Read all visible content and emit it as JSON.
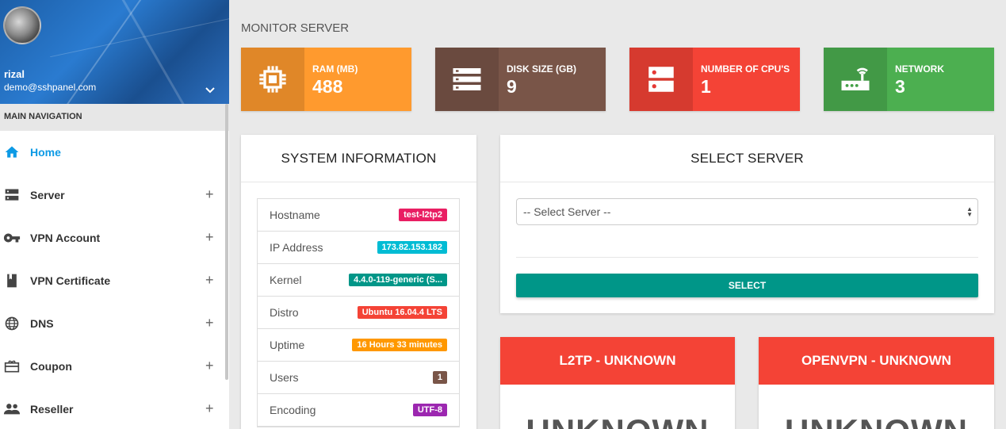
{
  "user": {
    "name": "rizal",
    "email": "demo@sshpanel.com"
  },
  "nav": {
    "header": "MAIN NAVIGATION",
    "items": [
      {
        "label": "Home",
        "icon": "home-icon",
        "active": true,
        "expandable": false
      },
      {
        "label": "Server",
        "icon": "server-icon",
        "active": false,
        "expandable": true
      },
      {
        "label": "VPN Account",
        "icon": "key-icon",
        "active": false,
        "expandable": true
      },
      {
        "label": "VPN Certificate",
        "icon": "certificate-icon",
        "active": false,
        "expandable": true
      },
      {
        "label": "DNS",
        "icon": "globe-icon",
        "active": false,
        "expandable": true
      },
      {
        "label": "Coupon",
        "icon": "coupon-icon",
        "active": false,
        "expandable": true
      },
      {
        "label": "Reseller",
        "icon": "people-icon",
        "active": false,
        "expandable": true
      }
    ],
    "expand_symbol": "+"
  },
  "page": {
    "title": "MONITOR SERVER"
  },
  "stats": [
    {
      "label": "RAM (MB)",
      "value": "488",
      "icon": "chip-icon",
      "color": "#ff9a2e"
    },
    {
      "label": "DISK SIZE (GB)",
      "value": "9",
      "icon": "storage-icon",
      "color": "#795548"
    },
    {
      "label": "NUMBER OF CPU'S",
      "value": "1",
      "icon": "dns-icon",
      "color": "#f44336"
    },
    {
      "label": "NETWORK",
      "value": "3",
      "icon": "router-icon",
      "color": "#4caf50"
    }
  ],
  "system_info": {
    "title": "SYSTEM INFORMATION",
    "rows": [
      {
        "key": "Hostname",
        "value": "test-l2tp2",
        "color": "#e91e63"
      },
      {
        "key": "IP Address",
        "value": "173.82.153.182",
        "color": "#00bcd4"
      },
      {
        "key": "Kernel",
        "value": "4.4.0-119-generic (S...",
        "color": "#009688"
      },
      {
        "key": "Distro",
        "value": "Ubuntu 16.04.4 LTS",
        "color": "#f44336"
      },
      {
        "key": "Uptime",
        "value": "16 Hours 33 minutes",
        "color": "#ff9800"
      },
      {
        "key": "Users",
        "value": "1",
        "color": "#795548"
      },
      {
        "key": "Encoding",
        "value": "UTF-8",
        "color": "#9c27b0"
      }
    ]
  },
  "select_server": {
    "title": "SELECT SERVER",
    "placeholder": "-- Select Server --",
    "button": "SELECT"
  },
  "status_cards": [
    {
      "title": "L2TP - UNKNOWN",
      "status": "UNKNOWN"
    },
    {
      "title": "OPENVPN - UNKNOWN",
      "status": "UNKNOWN"
    }
  ]
}
